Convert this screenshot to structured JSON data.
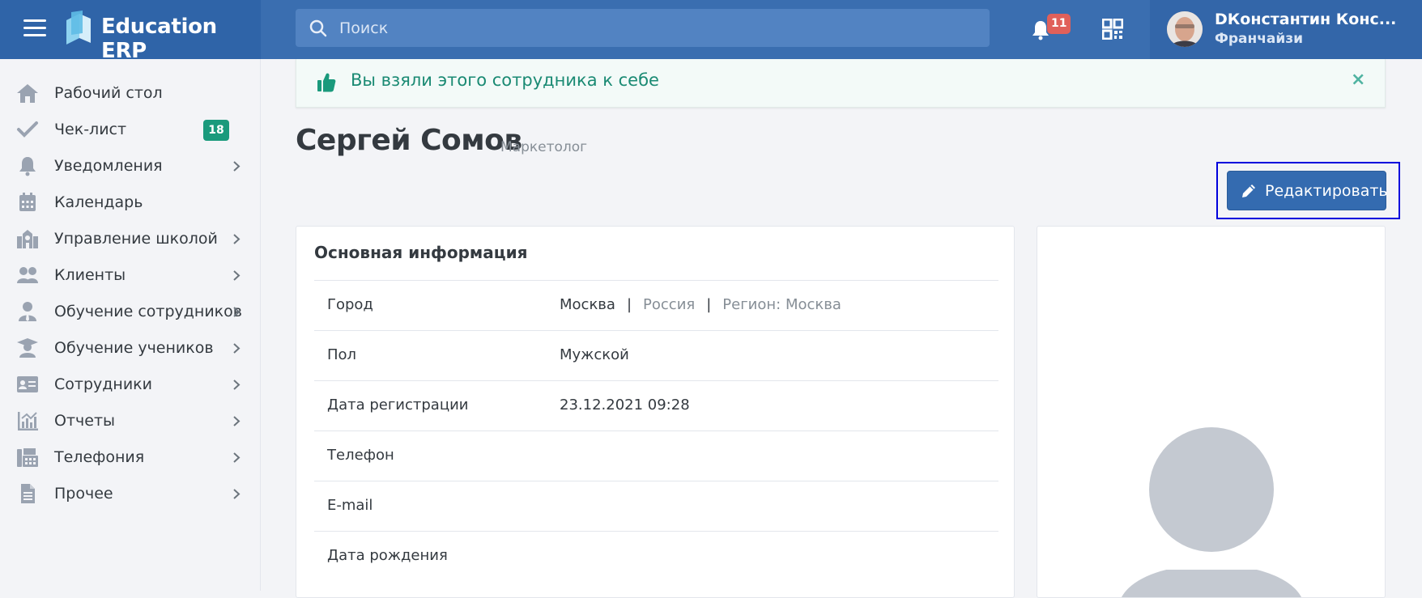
{
  "header": {
    "brand": "Education ERP",
    "search_placeholder": "Поиск",
    "notifications_count": "11",
    "user": {
      "name": "DКонстантин Конс...",
      "role": "Франчайзи"
    }
  },
  "sidebar": {
    "items": [
      {
        "label": "Рабочий стол",
        "icon": "home-icon",
        "chevron": false
      },
      {
        "label": "Чек-лист",
        "icon": "check-icon",
        "badge": "18",
        "chevron": false
      },
      {
        "label": "Уведомления",
        "icon": "bell-icon",
        "chevron": true
      },
      {
        "label": "Календарь",
        "icon": "calendar-icon",
        "chevron": false
      },
      {
        "label": "Управление школой",
        "icon": "school-icon",
        "chevron": true
      },
      {
        "label": "Клиенты",
        "icon": "users-icon",
        "chevron": true
      },
      {
        "label": "Обучение сотрудников",
        "icon": "user-tie-icon",
        "chevron": true
      },
      {
        "label": "Обучение учеников",
        "icon": "graduate-icon",
        "chevron": true
      },
      {
        "label": "Сотрудники",
        "icon": "id-card-icon",
        "chevron": true
      },
      {
        "label": "Отчеты",
        "icon": "chart-icon",
        "chevron": true
      },
      {
        "label": "Телефония",
        "icon": "fax-icon",
        "chevron": true
      },
      {
        "label": "Прочее",
        "icon": "file-icon",
        "chevron": true
      }
    ]
  },
  "alert": {
    "message": "Вы взяли этого сотрудника к себе",
    "close": "×"
  },
  "profile": {
    "name": "Сергей Сомов",
    "position": "Маркетолог",
    "edit_label": "Редактировать"
  },
  "info": {
    "title": "Основная информация",
    "rows": [
      {
        "key": "Город",
        "value": "Москва",
        "country": "Россия",
        "region": "Регион: Москва"
      },
      {
        "key": "Пол",
        "value": "Мужской"
      },
      {
        "key": "Дата регистрации",
        "value": "23.12.2021 09:28"
      },
      {
        "key": "Телефон",
        "value": ""
      },
      {
        "key": "E-mail",
        "value": ""
      },
      {
        "key": "Дата рождения",
        "value": ""
      }
    ]
  },
  "colors": {
    "topbar": "#3a6eb0",
    "accent": "#346bb0",
    "badge_green": "#1a9a7c",
    "badge_red": "#e0605a",
    "alert_text": "#1a8a73"
  }
}
